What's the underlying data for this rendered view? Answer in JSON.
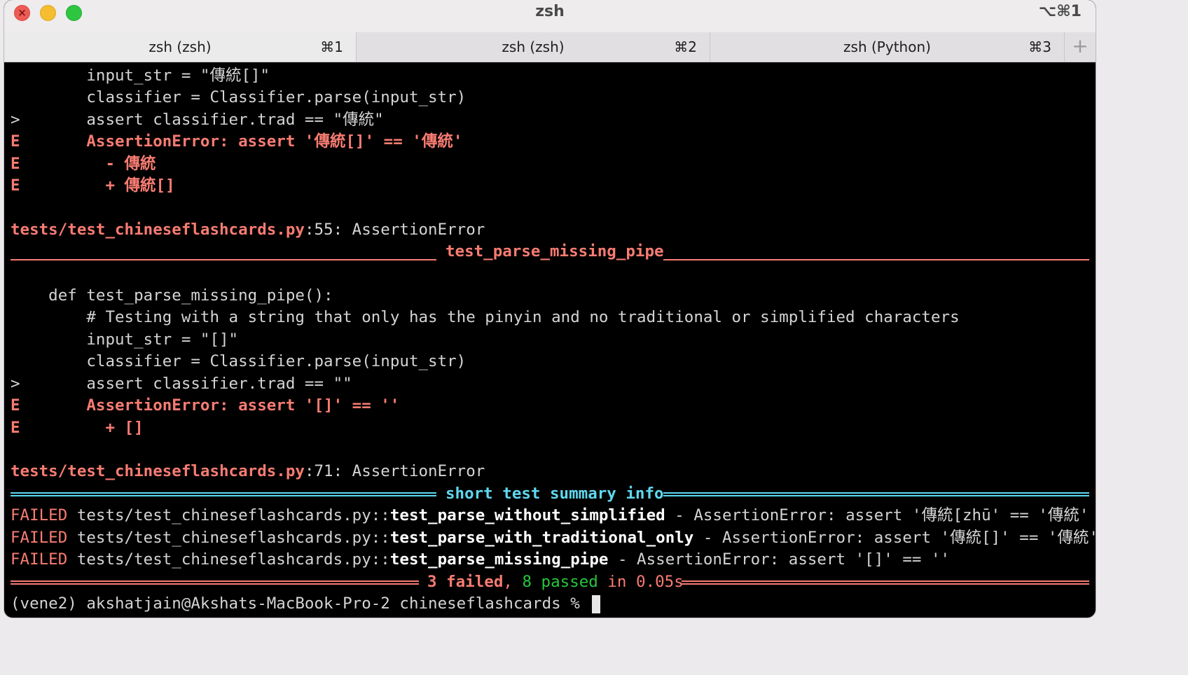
{
  "window": {
    "title": "zsh",
    "shortcut": "⌥⌘1",
    "close_glyph": "×"
  },
  "tabs": [
    {
      "label": "zsh (zsh)",
      "key": "⌘1"
    },
    {
      "label": "zsh (zsh)",
      "key": "⌘2"
    },
    {
      "label": "zsh (Python)",
      "key": "⌘3"
    }
  ],
  "tab_add": "+",
  "colors": {
    "error_red": "#f87c72",
    "info_cyan": "#5fd8ef",
    "pass_green": "#27c63e",
    "terminal_bg": "#000000"
  },
  "terminal": {
    "block1": {
      "l1": "        input_str = \"傳統[]\"",
      "l2": "        classifier = Classifier.parse(input_str)",
      "l3_marker": ">",
      "l3": "       assert classifier.trad == \"傳統\"",
      "l4_marker": "E",
      "l4": "       AssertionError: assert '傳統[]' == '傳統'",
      "l5_marker": "E",
      "l5": "         - 傳統",
      "l6_marker": "E",
      "l6": "         + 傳統[]"
    },
    "loc1": {
      "file": "tests/test_chineseflashcards.py",
      "rest": ":55: AssertionError"
    },
    "section_title": "test_parse_missing_pipe",
    "block2": {
      "l1": "    def test_parse_missing_pipe():",
      "l2": "        # Testing with a string that only has the pinyin and no traditional or simplified characters",
      "l3": "        input_str = \"[]\"",
      "l4": "        classifier = Classifier.parse(input_str)",
      "l5_marker": ">",
      "l5": "       assert classifier.trad == \"\"",
      "l6_marker": "E",
      "l6": "       AssertionError: assert '[]' == ''",
      "l7_marker": "E",
      "l7": "         + []"
    },
    "loc2": {
      "file": "tests/test_chineseflashcards.py",
      "rest": ":71: AssertionError"
    },
    "summary_title": "short test summary info",
    "failures": [
      {
        "status": "FAILED",
        "path": " tests/test_chineseflashcards.py::",
        "test": "test_parse_without_simplified",
        "msg": " - AssertionError: assert '傳統[zhū' == '傳統'"
      },
      {
        "status": "FAILED",
        "path": " tests/test_chineseflashcards.py::",
        "test": "test_parse_with_traditional_only",
        "msg": " - AssertionError: assert '傳統[]' == '傳統'"
      },
      {
        "status": "FAILED",
        "path": " tests/test_chineseflashcards.py::",
        "test": "test_parse_missing_pipe",
        "msg": " - AssertionError: assert '[]' == ''"
      }
    ],
    "result": {
      "failed": "3 failed",
      "comma": ", ",
      "passed": "8 passed",
      "time": " in 0.05s"
    },
    "prompt": "(vene2) akshatjain@Akshats-MacBook-Pro-2 chineseflashcards % "
  }
}
